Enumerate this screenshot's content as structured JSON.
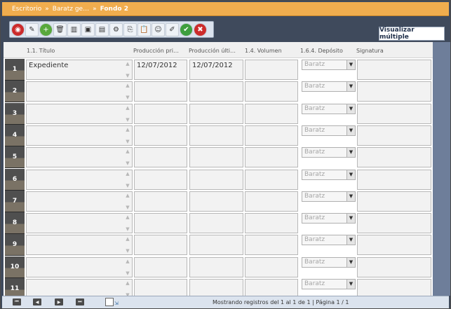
{
  "breadcrumb": {
    "items": [
      "Escritorio",
      "Baratz ge…",
      "Fondo 2"
    ],
    "separator": "»"
  },
  "toolbar": {
    "buttons": [
      {
        "name": "record-icon",
        "glyph": "◉"
      },
      {
        "name": "edit-icon",
        "glyph": "✎"
      },
      {
        "name": "add-icon",
        "glyph": "+"
      },
      {
        "name": "delete-icon",
        "glyph": "🗑"
      },
      {
        "name": "columns-icon",
        "glyph": "▥"
      },
      {
        "name": "image-icon",
        "glyph": "▣"
      },
      {
        "name": "window-icon",
        "glyph": "▤"
      },
      {
        "name": "tools-icon",
        "glyph": "⚙"
      },
      {
        "name": "copy-icon",
        "glyph": "⎘"
      },
      {
        "name": "paste-icon",
        "glyph": "📋"
      },
      {
        "name": "users-icon",
        "glyph": "☺"
      },
      {
        "name": "eraser-icon",
        "glyph": "✐"
      },
      {
        "name": "accept-icon",
        "glyph": "✔"
      },
      {
        "name": "cancel-icon",
        "glyph": "✖"
      }
    ],
    "visualize_label": "Visualizar múltiple"
  },
  "columns": [
    "1.1. Título",
    "Producción pri…",
    "Producción últi…",
    "1.4. Volumen",
    "1.6.4. Depósito",
    "Signatura"
  ],
  "rows": [
    {
      "num": "1",
      "titulo": "Expediente",
      "prod_pri": "12/07/2012",
      "prod_ult": "12/07/2012",
      "volumen": "",
      "deposito": "Baratz",
      "signatura": ""
    },
    {
      "num": "2",
      "titulo": "",
      "prod_pri": "",
      "prod_ult": "",
      "volumen": "",
      "deposito": "Baratz",
      "signatura": ""
    },
    {
      "num": "3",
      "titulo": "",
      "prod_pri": "",
      "prod_ult": "",
      "volumen": "",
      "deposito": "Baratz",
      "signatura": ""
    },
    {
      "num": "4",
      "titulo": "",
      "prod_pri": "",
      "prod_ult": "",
      "volumen": "",
      "deposito": "Baratz",
      "signatura": ""
    },
    {
      "num": "5",
      "titulo": "",
      "prod_pri": "",
      "prod_ult": "",
      "volumen": "",
      "deposito": "Baratz",
      "signatura": ""
    },
    {
      "num": "6",
      "titulo": "",
      "prod_pri": "",
      "prod_ult": "",
      "volumen": "",
      "deposito": "Baratz",
      "signatura": ""
    },
    {
      "num": "7",
      "titulo": "",
      "prod_pri": "",
      "prod_ult": "",
      "volumen": "",
      "deposito": "Baratz",
      "signatura": ""
    },
    {
      "num": "8",
      "titulo": "",
      "prod_pri": "",
      "prod_ult": "",
      "volumen": "",
      "deposito": "Baratz",
      "signatura": ""
    },
    {
      "num": "9",
      "titulo": "",
      "prod_pri": "",
      "prod_ult": "",
      "volumen": "",
      "deposito": "Baratz",
      "signatura": ""
    },
    {
      "num": "10",
      "titulo": "",
      "prod_pri": "",
      "prod_ult": "",
      "volumen": "",
      "deposito": "Baratz",
      "signatura": ""
    },
    {
      "num": "11",
      "titulo": "",
      "prod_pri": "",
      "prod_ult": "",
      "volumen": "",
      "deposito": "Baratz",
      "signatura": ""
    }
  ],
  "footer": {
    "status": "Mostrando registros del 1 al 1 de 1 | Página 1 / 1",
    "nav": [
      {
        "name": "first-page-icon",
        "glyph": "⏮"
      },
      {
        "name": "prev-page-icon",
        "glyph": "◀"
      },
      {
        "name": "next-page-icon",
        "glyph": "▶"
      },
      {
        "name": "last-page-icon",
        "glyph": "⏭"
      }
    ]
  },
  "colors": {
    "topbar": "#f0ad4e",
    "frame": "#3f4a5c",
    "right_panel": "#6e7e9a"
  }
}
